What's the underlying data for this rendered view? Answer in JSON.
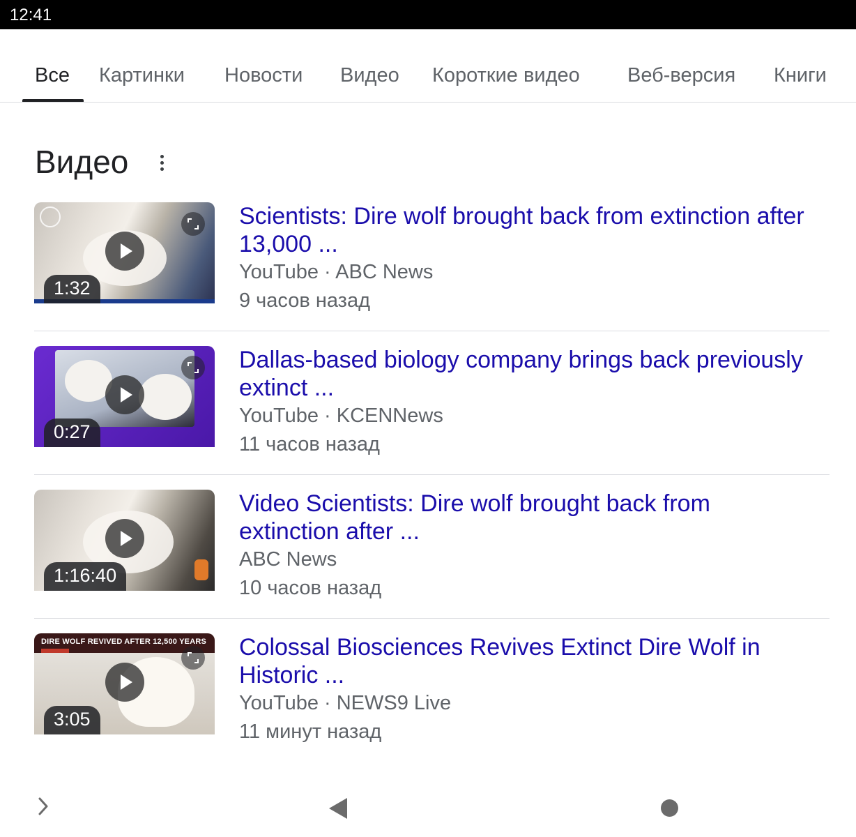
{
  "status_bar": {
    "time": "12:41"
  },
  "tabs": [
    {
      "label": "Все",
      "active": true
    },
    {
      "label": "Картинки",
      "active": false
    },
    {
      "label": "Новости",
      "active": false
    },
    {
      "label": "Видео",
      "active": false
    },
    {
      "label": "Короткие видео",
      "active": false
    },
    {
      "label": "Веб-версия",
      "active": false
    },
    {
      "label": "Книги",
      "active": false
    }
  ],
  "section": {
    "title": "Видео",
    "menu_icon": "more-vert-icon"
  },
  "results": [
    {
      "title": "Scientists: Dire wolf brought back from extinction after 13,000 ...",
      "source": "YouTube · ABC News",
      "time": "9 часов назад",
      "duration": "1:32",
      "thumb_caption": ""
    },
    {
      "title": "Dallas-based biology company brings back previously extinct ...",
      "source": "YouTube · KCENNews",
      "time": "11 часов назад",
      "duration": "0:27",
      "thumb_caption": ""
    },
    {
      "title": "Video Scientists: Dire wolf brought back from extinction after ...",
      "source": "ABC News",
      "time": "10 часов назад",
      "duration": "1:16:40",
      "thumb_caption": ""
    },
    {
      "title": "Colossal Biosciences Revives Extinct Dire Wolf in Historic ...",
      "source": "YouTube · NEWS9 Live",
      "time": "11 минут назад",
      "duration": "3:05",
      "thumb_caption": "DIRE WOLF REVIVED AFTER 12,500 YEARS"
    }
  ],
  "colors": {
    "link": "#1a0dab",
    "meta": "#5f6368",
    "thumb2_accent": "#5a1fb8"
  },
  "navbar": {
    "icons": [
      "chevron-right-icon",
      "back-icon",
      "home-icon"
    ]
  }
}
